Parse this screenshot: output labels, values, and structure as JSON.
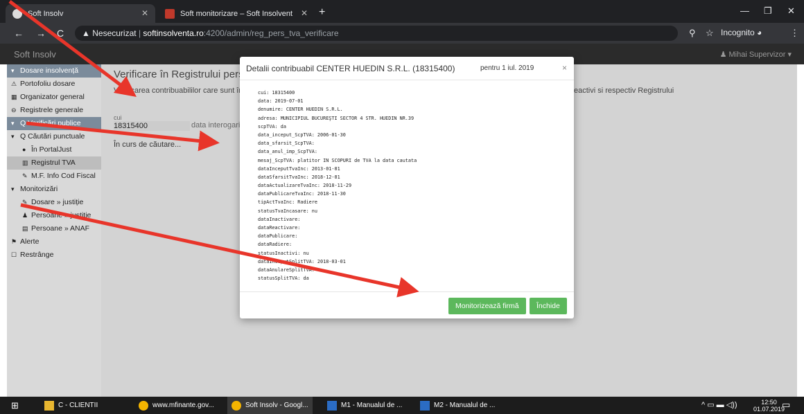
{
  "browser": {
    "tabs": [
      {
        "title": "Soft Insolv",
        "icon": "soft-insolv-icon"
      },
      {
        "title": "Soft monitorizare – Soft Insolvent",
        "icon": "monitor-icon"
      }
    ],
    "url_warning": "Nesecurizat",
    "url_host": "softinsolventa.ro",
    "url_path": ":4200/admin/reg_pers_tva_verificare",
    "incognito_label": "Incognito"
  },
  "app": {
    "brand": "Soft Insolv",
    "user": "Mihai Supervizor"
  },
  "sidebar": {
    "items": [
      {
        "label": "Dosare insolvență",
        "level": "head",
        "icon": "▾"
      },
      {
        "label": "Portofoliu dosare",
        "level": "l1",
        "icon": "⚠"
      },
      {
        "label": "Organizator general",
        "level": "l1",
        "icon": "▦"
      },
      {
        "label": "Registrele generale",
        "level": "l1",
        "icon": "⊖"
      },
      {
        "label": "Q Verificări publice",
        "level": "head",
        "icon": "▾"
      },
      {
        "label": "Q Căutări punctuale",
        "level": "l1",
        "icon": "▾"
      },
      {
        "label": "În PortalJust",
        "level": "l3",
        "icon": "●"
      },
      {
        "label": "Registrul TVA",
        "level": "l3",
        "icon": "▥",
        "selected": true
      },
      {
        "label": "M.F. Info Cod Fiscal",
        "level": "l3",
        "icon": "✎"
      },
      {
        "label": "Monitorizări",
        "level": "l1",
        "icon": "▾"
      },
      {
        "label": "Dosare » justiție",
        "level": "l3",
        "icon": "✎"
      },
      {
        "label": "Persoane » justiție",
        "level": "l3",
        "icon": "♟"
      },
      {
        "label": "Persoane » ANAF",
        "level": "l3",
        "icon": "▤"
      },
      {
        "label": "Alerte",
        "level": "l1",
        "icon": "⚑"
      },
      {
        "label": "Restrânge",
        "level": "l1",
        "icon": "☐"
      }
    ]
  },
  "main": {
    "title": "Verificare în Registrului persoanelor impozabile înregistrate în scopuri de TVA",
    "description": "Verificarea contribuabililor care sunt înregistrați în scopuri de TVA, în sistemul Tva la incasare, conform Registrului contribuabililor activi/reactivi si respectiv Registrului",
    "cui_label": "cui",
    "cui_value": "18315400",
    "data_label": "data interogarii",
    "status": "În curs de căutare..."
  },
  "modal": {
    "title_prefix": "Detalii contribuabil ",
    "title_name": "CENTER HUEDIN S.R.L.",
    "title_cui": " (18315400)",
    "date": "pentru 1 iul. 2019",
    "lines": [
      "cui: 18315400",
      "data: 2019-07-01",
      "denumire: CENTER HUEDIN S.R.L.",
      "adresa: MUNICIPIUL BUCUREŞTI SECTOR 4 STR. HUEDIN NR.39",
      "scpTVA: da",
      "data_inceput_ScpTVA: 2006-01-30",
      "data_sfarsit_ScpTVA:",
      "data_anul_imp_ScpTVA:",
      "mesaj_ScpTVA: platitor IN SCOPURI de TVA la data cautata",
      "dataInceputTvaInc: 2013-01-01",
      "dataSfarsitTvaInc: 2018-12-01",
      "dataActualizareTvaInc: 2018-11-29",
      "dataPublicareTvaInc: 2018-11-30",
      "tipActTvaInc: Radiere",
      "statusTvaIncasare: nu",
      "dataInactivare:",
      "dataReactivare:",
      "dataPublicare:",
      "dataRadiere:",
      "statusInactivi: nu",
      "dataInceputSplitTVA: 2018-03-01",
      "dataAnulareSplitTVA:",
      "statusSplitTVA: da"
    ],
    "monitor_button": "Monitorizează firmă",
    "close_button": "Închide"
  },
  "taskbar": {
    "items": [
      "C - CLIENTII",
      "www.mfinante.gov...",
      "Soft Insolv - Googl...",
      "M1 - Manualul de ...",
      "M2 - Manualul de ..."
    ],
    "time": "12:50",
    "date": "01.07.2019"
  },
  "colors": {
    "annotation_arrow": "#e8352a",
    "button_green": "#5cb85c",
    "sidebar_head": "#7b8b9b"
  }
}
